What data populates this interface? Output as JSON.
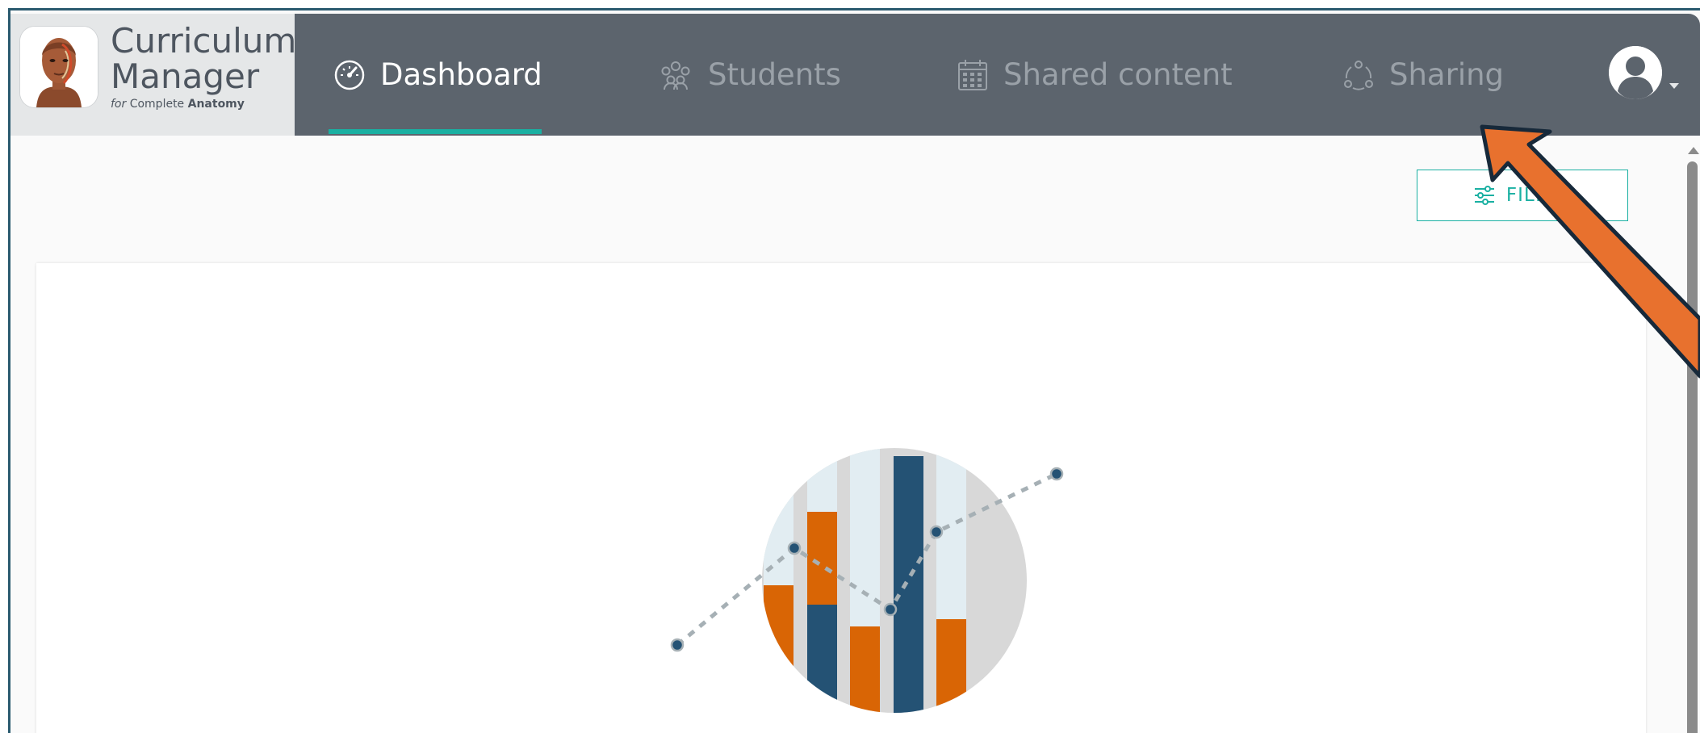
{
  "app": {
    "title_line1": "Curriculum",
    "title_line2": "Manager",
    "subtitle_for": "for",
    "subtitle_complete": " Complete ",
    "subtitle_anatomy": "Anatomy"
  },
  "nav": {
    "tabs": [
      {
        "label": "Dashboard",
        "icon": "speedometer-icon",
        "active": true
      },
      {
        "label": "Students",
        "icon": "people-group-icon",
        "active": false
      },
      {
        "label": "Shared content",
        "icon": "calendar-icon",
        "active": false
      },
      {
        "label": "Sharing",
        "icon": "share-network-icon",
        "active": false
      }
    ]
  },
  "user": {
    "avatar_icon": "user-avatar-icon"
  },
  "toolbar": {
    "filter_label": "FILTER"
  },
  "colors": {
    "header": "#5c646d",
    "brand_bg": "#e5e7e8",
    "accent": "#1ab0a2",
    "annotation_arrow": "#e8712e",
    "chart_orange": "#d96505",
    "chart_navy": "#245274"
  }
}
